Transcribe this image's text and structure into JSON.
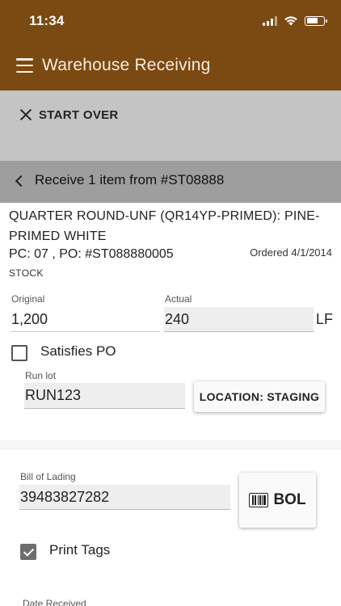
{
  "status_bar": {
    "time": "11:34"
  },
  "app_bar": {
    "title": "Warehouse Receiving"
  },
  "start_over": {
    "label": "START OVER"
  },
  "sub_header": {
    "title": "Receive 1 item from #ST08888"
  },
  "item": {
    "description": "QUARTER ROUND-UNF (QR14YP-PRIMED): PINE-PRIMED WHITE",
    "pc_po": "PC: 07 , PO: #ST088880005",
    "ordered": "Ordered 4/1/2014",
    "type": "STOCK"
  },
  "quantities": {
    "original_label": "Original",
    "original_value": "1,200",
    "actual_label": "Actual",
    "actual_value": "240",
    "unit": "LF"
  },
  "satisfies_po": {
    "label": "Satisfies PO",
    "checked": false
  },
  "run_lot": {
    "label": "Run lot",
    "value": "RUN123"
  },
  "location_button": {
    "label": "LOCATION: STAGING"
  },
  "bill_of_lading": {
    "label": "Bill of Lading",
    "value": "39483827282"
  },
  "bol_button": {
    "label": "BOL",
    "icon": "barcode-icon"
  },
  "print_tags": {
    "label": "Print Tags",
    "checked": true
  },
  "date_received": {
    "label": "Date Received"
  },
  "colors": {
    "brand": "#7b4a12",
    "start_over_bar": "#c4c4c4",
    "sub_header": "#9e9e9e"
  }
}
